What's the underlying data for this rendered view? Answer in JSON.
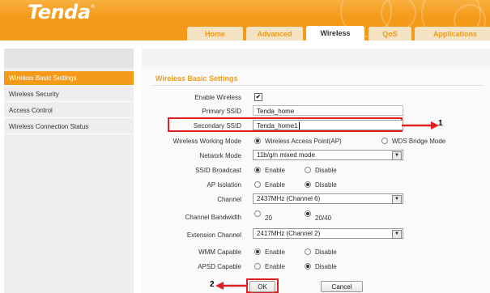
{
  "brand": {
    "logo": "Tenda",
    "reg_mark": "®",
    "accent": "#f59a18",
    "highlight": "#e02020"
  },
  "tabs": [
    {
      "label": "Home",
      "active": false
    },
    {
      "label": "Advanced",
      "active": false
    },
    {
      "label": "Wireless",
      "active": true
    },
    {
      "label": "QoS",
      "active": false
    },
    {
      "label": "Applications",
      "active": false
    }
  ],
  "sidebar": {
    "items": [
      {
        "label": "Wireless Basic Settings",
        "active": true
      },
      {
        "label": "Wireless Security",
        "active": false
      },
      {
        "label": "Access Control",
        "active": false
      },
      {
        "label": "Wireless Connection Status",
        "active": false
      }
    ]
  },
  "form": {
    "title": "Wireless Basic Settings",
    "enable_wireless": {
      "label": "Enable Wireless",
      "checked": true,
      "mark": "✔"
    },
    "primary_ssid": {
      "label": "Primary SSID",
      "value": "Tenda_home"
    },
    "secondary_ssid": {
      "label": "Secondary SSID",
      "value": "Tenda_home1"
    },
    "working_mode": {
      "label": "Wireless Working Mode",
      "options": [
        "Wireless Access Point(AP)",
        "WDS Bridge Mode"
      ],
      "selected": "Wireless Access Point(AP)"
    },
    "network_mode": {
      "label": "Network Mode",
      "value": "11b/g/n mixed mode"
    },
    "ssid_broadcast": {
      "label": "SSID Broadcast",
      "options": [
        "Enable",
        "Disable"
      ],
      "selected": "Enable"
    },
    "ap_isolation": {
      "label": "AP Isolation",
      "options": [
        "Enable",
        "Disable"
      ],
      "selected": "Disable"
    },
    "channel": {
      "label": "Channel",
      "value": "2437MHz (Channel 6)"
    },
    "channel_bandwidth": {
      "label": "Channel Bandwidth",
      "options": [
        "20",
        "20/40"
      ],
      "selected": "20/40"
    },
    "extension_channel": {
      "label": "Extension Channel",
      "value": "2417MHz (Channel 2)"
    },
    "wmm_capable": {
      "label": "WMM Capable",
      "options": [
        "Enable",
        "Disable"
      ],
      "selected": "Enable"
    },
    "apsd_capable": {
      "label": "APSD Capable",
      "options": [
        "Enable",
        "Disable"
      ],
      "selected": "Disable"
    },
    "ok_label": "OK",
    "cancel_label": "Cancel"
  },
  "annotations": {
    "marker_1": "1",
    "marker_2": "2"
  }
}
